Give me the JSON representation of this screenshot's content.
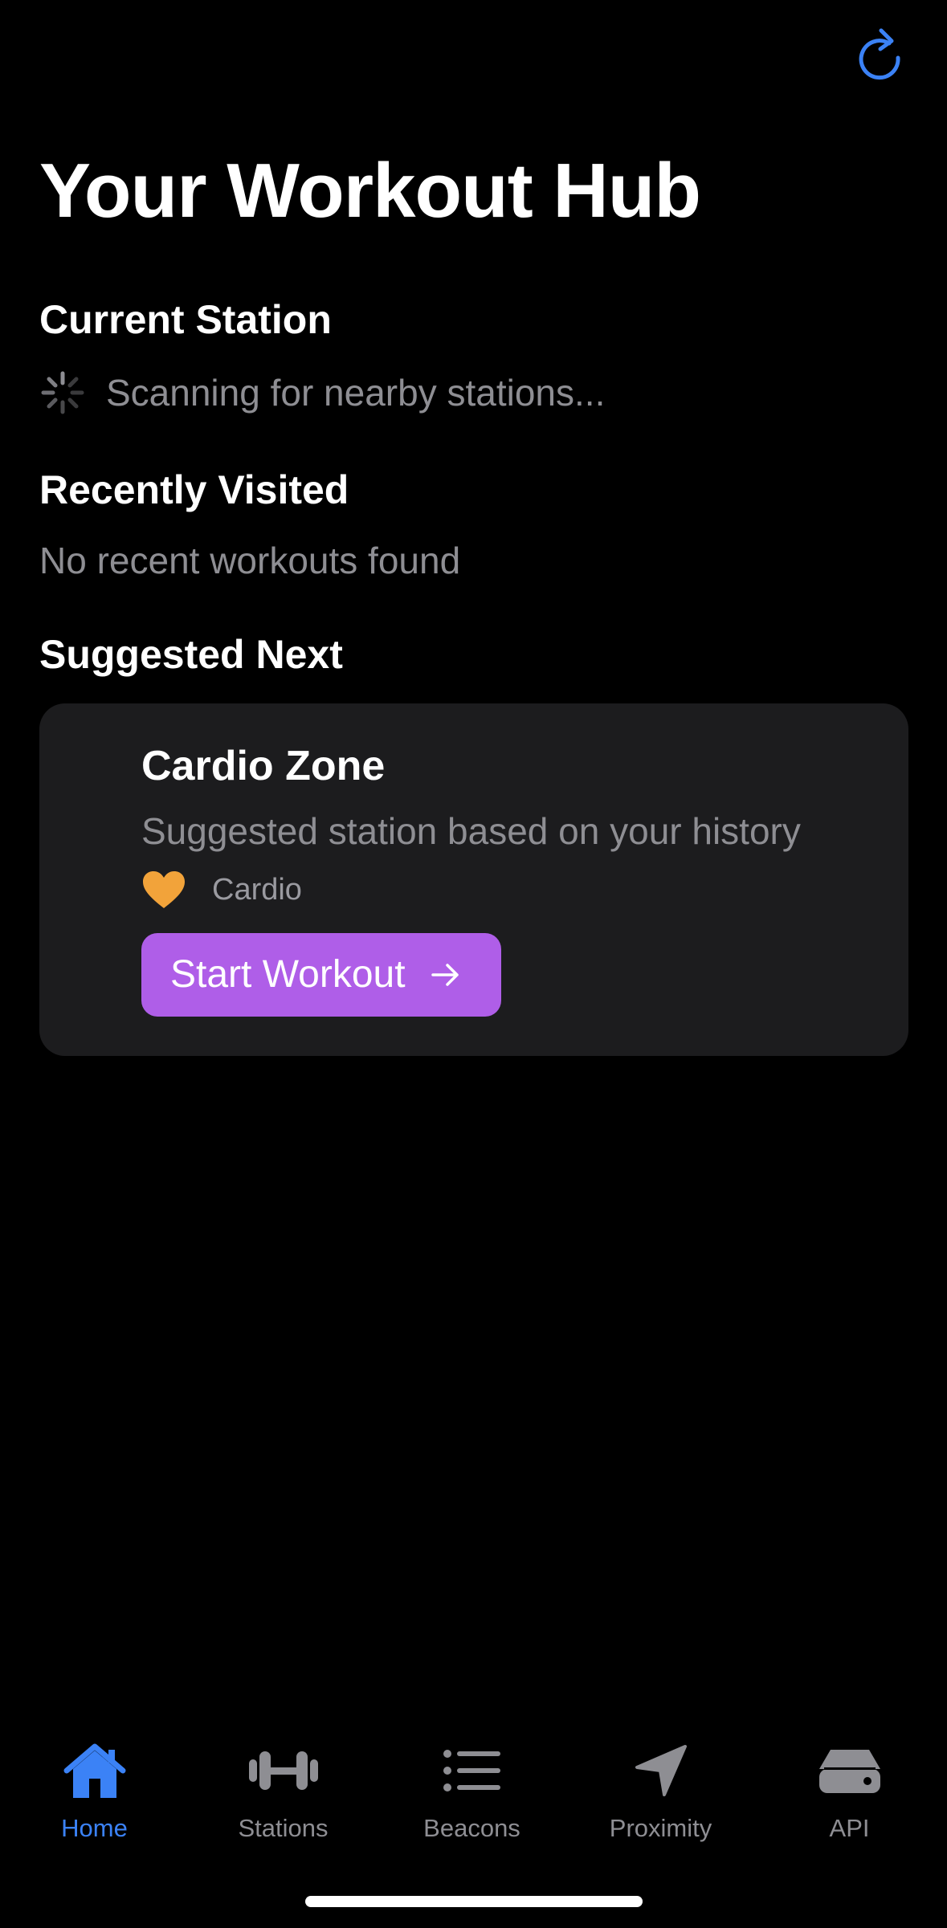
{
  "header": {
    "refresh_icon": "arrow-clockwise-icon",
    "accent_color": "#3b82f6",
    "title": "Your Workout Hub"
  },
  "current_station": {
    "heading": "Current Station",
    "status_text": "Scanning for nearby stations...",
    "status_icon": "loading-spinner-icon"
  },
  "recently_visited": {
    "heading": "Recently Visited",
    "empty_text": "No recent workouts found"
  },
  "suggested": {
    "heading": "Suggested Next",
    "card": {
      "title": "Cardio Zone",
      "subtitle": "Suggested station based on your history",
      "category_icon": "heart-icon",
      "category_color": "#f2a33a",
      "category": "Cardio",
      "button_label": "Start Workout",
      "button_color": "#af5ee8",
      "button_icon": "arrow-right-icon"
    }
  },
  "tabbar": {
    "tabs": [
      {
        "label": "Home",
        "icon": "house-icon",
        "active": true
      },
      {
        "label": "Stations",
        "icon": "dumbbell-icon",
        "active": false
      },
      {
        "label": "Beacons",
        "icon": "list-icon",
        "active": false
      },
      {
        "label": "Proximity",
        "icon": "location-arrow-icon",
        "active": false
      },
      {
        "label": "API",
        "icon": "server-drive-icon",
        "active": false
      }
    ],
    "active_color": "#3b82f6",
    "inactive_color": "#8e8e93"
  }
}
